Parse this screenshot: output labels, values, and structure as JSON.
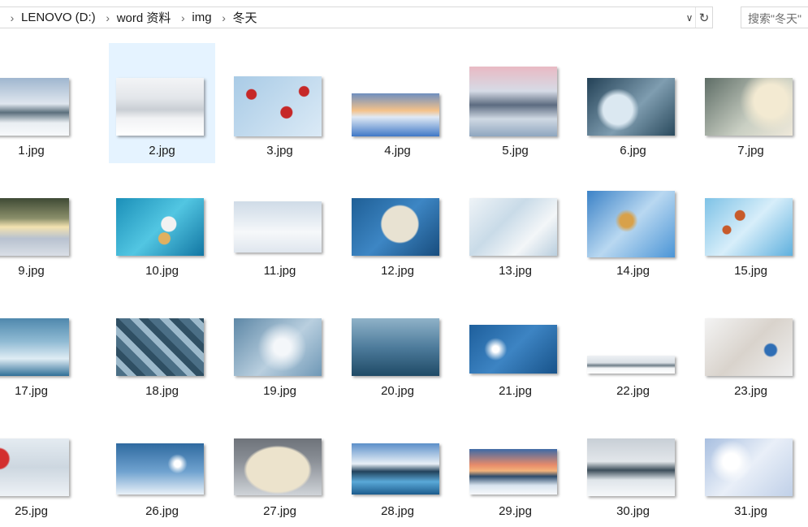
{
  "address_bar": {
    "breadcrumbs": [
      "LENOVO (D:)",
      "word 资料",
      "img",
      "冬天"
    ],
    "dropdown_icon": "chevron-down-icon",
    "refresh_icon": "refresh-icon"
  },
  "search": {
    "placeholder": "搜索\"冬天\""
  },
  "files": [
    {
      "name": "1.jpg"
    },
    {
      "name": "2.jpg"
    },
    {
      "name": "3.jpg"
    },
    {
      "name": "4.jpg"
    },
    {
      "name": "5.jpg"
    },
    {
      "name": "6.jpg"
    },
    {
      "name": "7.jpg"
    },
    {
      "name": "9.jpg"
    },
    {
      "name": "10.jpg"
    },
    {
      "name": "11.jpg"
    },
    {
      "name": "12.jpg"
    },
    {
      "name": "13.jpg"
    },
    {
      "name": "14.jpg"
    },
    {
      "name": "15.jpg"
    },
    {
      "name": "17.jpg"
    },
    {
      "name": "18.jpg"
    },
    {
      "name": "19.jpg"
    },
    {
      "name": "20.jpg"
    },
    {
      "name": "21.jpg"
    },
    {
      "name": "22.jpg"
    },
    {
      "name": "23.jpg"
    },
    {
      "name": "25.jpg"
    },
    {
      "name": "26.jpg"
    },
    {
      "name": "27.jpg"
    },
    {
      "name": "28.jpg"
    },
    {
      "name": "29.jpg"
    },
    {
      "name": "30.jpg"
    },
    {
      "name": "31.jpg"
    }
  ],
  "selected_file": "2.jpg"
}
